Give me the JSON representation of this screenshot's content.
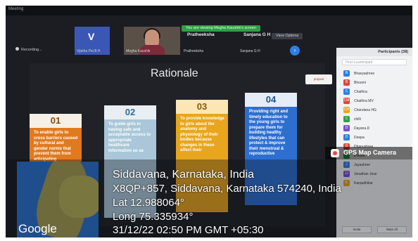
{
  "app": {
    "label": "Meeting"
  },
  "banner": {
    "viewing_text": "You are viewing Megha Kaushik's screen",
    "view_options": "View Options"
  },
  "recording": {
    "label": "Recording..."
  },
  "participants_thumbs": [
    {
      "name": "Vijetha Pai B H",
      "initial": "V"
    },
    {
      "name": "Megha Kaushik"
    },
    {
      "name": "Pratheeksha",
      "sub": "Pratheeksha"
    },
    {
      "name": "Sanjana G H",
      "sub": "Sanjana G H"
    }
  ],
  "slide": {
    "title": "Rationale",
    "logo_text": "prajwal",
    "cards": [
      {
        "num": "01",
        "text": "To enable girls to cross barriers caused by cultural and gender norms that prevent them from articipating"
      },
      {
        "num": "02",
        "text": "To guide girls in having safe and acceptable access to appropriate healthcare information so as"
      },
      {
        "num": "03",
        "text": "To provide knowledge to girls about the anatomy and physiology of their bodies because changes in these affect their"
      },
      {
        "num": "04",
        "text": "Providing right and timely education to the young girls to prepare them for building healthy lifestyles that can protect & improve their menstrual & reproductive"
      }
    ]
  },
  "participants_panel": {
    "title": "Participants (38)",
    "search_placeholder": "Find a participant",
    "items": [
      {
        "name": "Bhavyashree",
        "initial": "B",
        "color": "#2f7ee6"
      },
      {
        "name": "Bhoomi",
        "initial": "B",
        "color": "#e0453c"
      },
      {
        "name": "Chaithra",
        "initial": "C",
        "color": "#2f7ee6"
      },
      {
        "name": "Chaithra MV",
        "initial": "CM",
        "color": "#e0453c"
      },
      {
        "name": "Chandana HG",
        "initial": "CH",
        "color": "#e8a51e"
      },
      {
        "name": "chilli",
        "initial": "C",
        "color": "#2ea043"
      },
      {
        "name": "Dayana.D",
        "initial": "D",
        "color": "#7b4fd1"
      },
      {
        "name": "Deepa",
        "initial": "D",
        "color": "#2f7ee6"
      },
      {
        "name": "Dhanushree",
        "initial": "D",
        "color": "#e0453c"
      },
      {
        "name": "iPhone",
        "initial": "i",
        "color": "#2ea043"
      },
      {
        "name": "Jayashree",
        "initial": "J",
        "color": "#2f7ee6"
      },
      {
        "name": "Jonathan Jose",
        "initial": "JJ",
        "color": "#7b4fd1"
      },
      {
        "name": "Karpadhikar",
        "initial": "K",
        "color": "#e8a51e"
      }
    ],
    "invite": "Invite",
    "mute_all": "Mute All"
  },
  "gps": {
    "app_label": "GPS Map Camera",
    "map_brand": "Google",
    "place": "Siddavana, Karnataka, India",
    "address": "X8QP+857, Siddavana, Karnataka 574240, India",
    "lat": "Lat 12.988064°",
    "long": "Long 75.335934°",
    "datetime": "31/12/22 02:50 PM GMT +05:30"
  }
}
